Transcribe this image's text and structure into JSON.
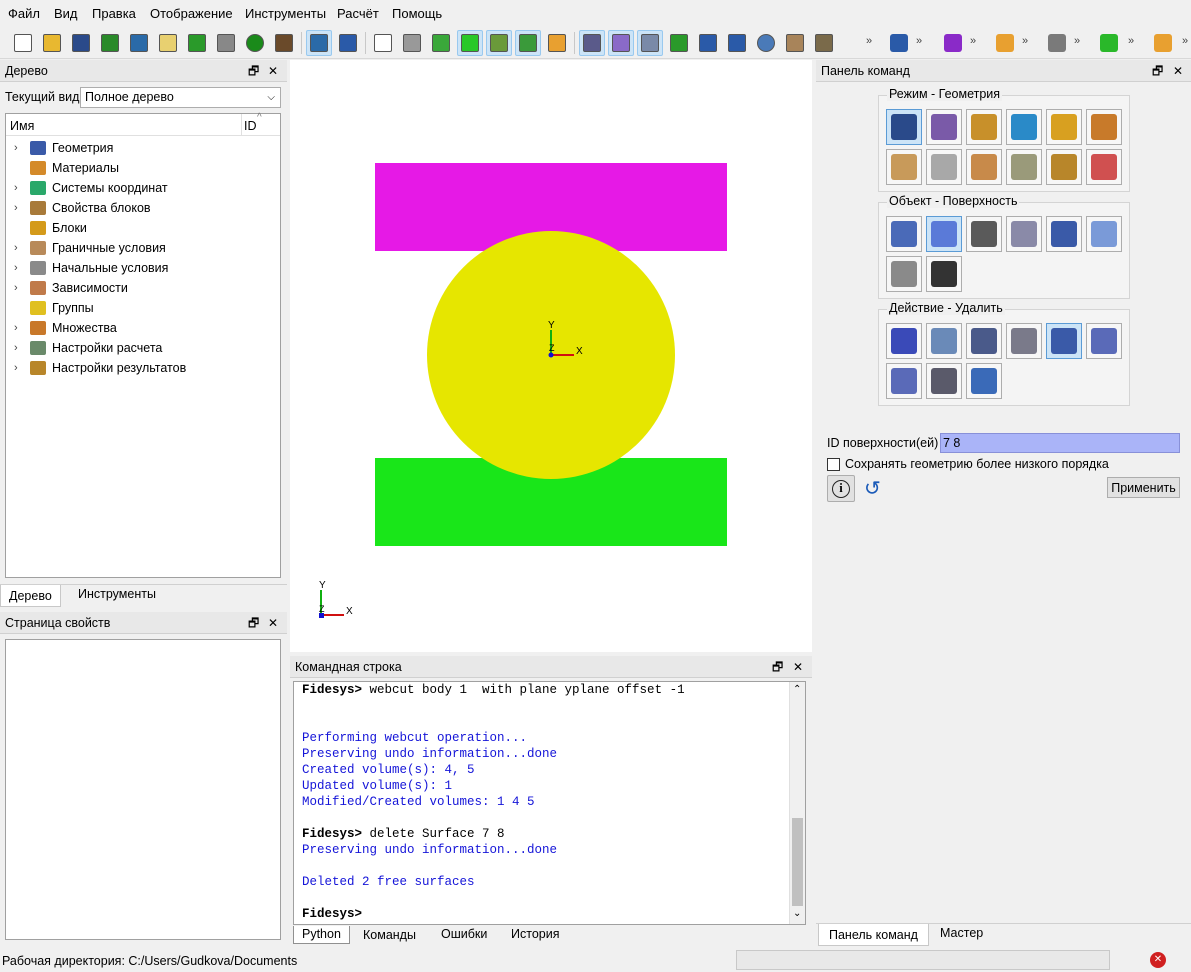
{
  "menu": [
    "Файл",
    "Вид",
    "Правка",
    "Отображение",
    "Инструменты",
    "Расчёт",
    "Помощь"
  ],
  "toolbar": {
    "icons": [
      "new-file-icon",
      "open-folder-icon",
      "save-icon",
      "check-icon",
      "export-icon",
      "edit-icon",
      "play-icon",
      "id-icon",
      "pause-icon",
      "hammer-icon",
      "undo-view-icon",
      "undo-icon",
      "wireframe-cube-icon",
      "gray-cube-icon",
      "green-cube-icon",
      "solid-green-cube-icon",
      "shapes-icon",
      "mesh-cube-icon",
      "group-icon",
      "grid-icon",
      "purple-cube-icon",
      "window-icon",
      "refresh-icon",
      "zoom-in-icon",
      "zoom-out-icon",
      "globe-icon",
      "box-icon",
      "ruler-icon"
    ],
    "extra_icons": [
      "people-icon",
      "crosshair-icon",
      "arrow-down-icon",
      "transform-icon",
      "run-icon",
      "axis-icon"
    ]
  },
  "tree_panel": {
    "title": "Дерево",
    "view_label": "Текущий вид",
    "view_value": "Полное дерево",
    "col_name": "Имя",
    "col_id": "ID",
    "items": [
      {
        "label": "Геометрия",
        "color": "#3a5aa8",
        "arrow": "›"
      },
      {
        "label": "Материалы",
        "color": "#d48a2a",
        "arrow": ""
      },
      {
        "label": "Системы координат",
        "color": "#2aa86a",
        "arrow": "›"
      },
      {
        "label": "Свойства блоков",
        "color": "#a87a3a",
        "arrow": "›"
      },
      {
        "label": "Блоки",
        "color": "#d49a1a",
        "arrow": ""
      },
      {
        "label": "Граничные условия",
        "color": "#b88a5a",
        "arrow": "›"
      },
      {
        "label": "Начальные условия",
        "color": "#8a8a8a",
        "arrow": "›"
      },
      {
        "label": "Зависимости",
        "color": "#c07a4a",
        "arrow": "›"
      },
      {
        "label": "Группы",
        "color": "#e0c020",
        "arrow": ""
      },
      {
        "label": "Множества",
        "color": "#c8782a",
        "arrow": "›"
      },
      {
        "label": "Настройки расчета",
        "color": "#6a8a6a",
        "arrow": "›"
      },
      {
        "label": "Настройки результатов",
        "color": "#b8862a",
        "arrow": "›"
      }
    ],
    "tabs": [
      "Дерево",
      "Инструменты"
    ]
  },
  "props_panel": {
    "title": "Страница свойств"
  },
  "viewport": {
    "colors": {
      "top_rect": "#e619e6",
      "circle": "#e6e600",
      "bottom_rect": "#19e619"
    },
    "axis_x": "X",
    "axis_y": "Y",
    "axis_z": "Z"
  },
  "console": {
    "title": "Командная строка",
    "lines": [
      {
        "type": "prompt",
        "prefix": "Fidesys>",
        "text": " webcut body 1  with plane yplane offset -1"
      },
      {
        "type": "blank",
        "text": ""
      },
      {
        "type": "blank",
        "text": ""
      },
      {
        "type": "out",
        "text": "Performing webcut operation..."
      },
      {
        "type": "out",
        "text": "Preserving undo information...done"
      },
      {
        "type": "out",
        "text": "Created volume(s): 4, 5"
      },
      {
        "type": "out",
        "text": "Updated volume(s): 1"
      },
      {
        "type": "out",
        "text": "Modified/Created volumes: 1 4 5"
      },
      {
        "type": "blank",
        "text": ""
      },
      {
        "type": "prompt",
        "prefix": "Fidesys>",
        "text": " delete Surface 7 8"
      },
      {
        "type": "out",
        "text": "Preserving undo information...done"
      },
      {
        "type": "blank",
        "text": ""
      },
      {
        "type": "out",
        "text": "Deleted 2 free surfaces"
      },
      {
        "type": "blank",
        "text": ""
      },
      {
        "type": "prompt",
        "prefix": "Fidesys>",
        "text": ""
      }
    ],
    "tabs": [
      "Python",
      "Команды",
      "Ошибки",
      "История"
    ]
  },
  "command_panel": {
    "title": "Панель команд",
    "group_mode": "Режим - Геометрия",
    "group_object": "Объект - Поверхность",
    "group_action": "Действие - Удалить",
    "mode_icons": [
      "geometry-icon",
      "mesh-icon",
      "tools-icon",
      "coord-axis-icon",
      "blocks-icon",
      "sets-icon",
      "boundary-icon",
      "initial-cond-icon",
      "chart-icon",
      "calculator-icon",
      "results-icon",
      "search-icon"
    ],
    "object_icons": [
      "volume-icon",
      "surface-icon",
      "curve-icon",
      "vertex-icon",
      "group-icon",
      "body-icon",
      "measure-icon",
      "text-icon"
    ],
    "action_icons": [
      "create-icon",
      "modify-icon",
      "transform-icon",
      "properties-icon",
      "delete-icon",
      "copy-icon",
      "boolean-icon",
      "decompose-icon",
      "imprint-icon"
    ],
    "surface_id_label": "ID поверхности(ей)",
    "surface_id_value": "7 8",
    "keep_lower_label": "Сохранять геометрию более низкого порядка",
    "apply_label": "Применить",
    "tabs": [
      "Панель команд",
      "Мастер"
    ]
  },
  "status": {
    "workdir": "Рабочая директория: C:/Users/Gudkova/Documents"
  }
}
